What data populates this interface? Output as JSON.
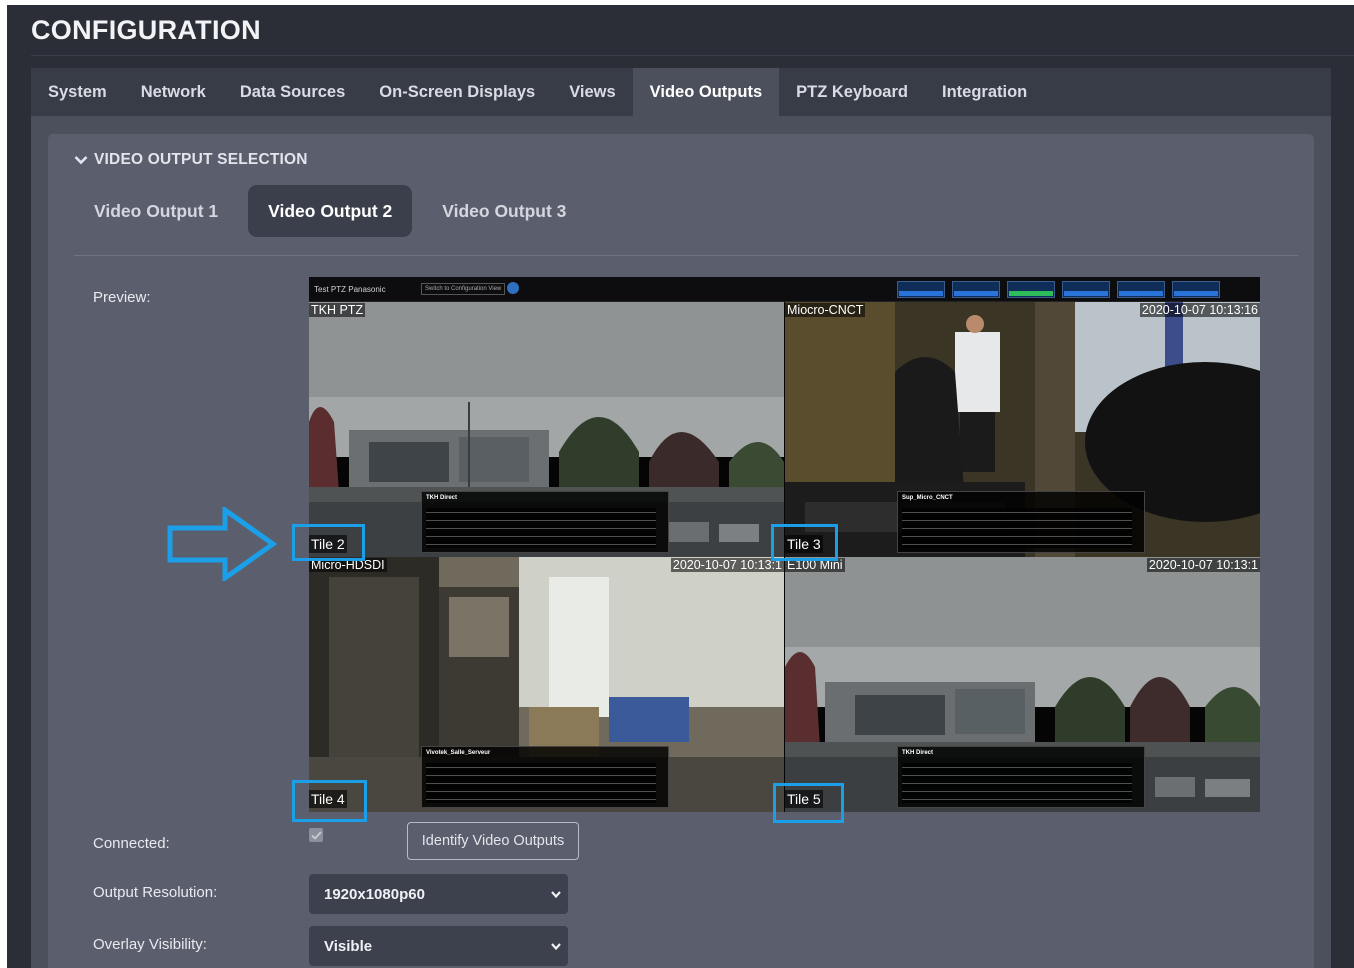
{
  "page": {
    "title": "CONFIGURATION"
  },
  "tabs": [
    "System",
    "Network",
    "Data Sources",
    "On-Screen Displays",
    "Views",
    "Video Outputs",
    "PTZ Keyboard",
    "Integration"
  ],
  "active_tab": "Video Outputs",
  "section": {
    "title": "VIDEO OUTPUT SELECTION",
    "expanded": true
  },
  "subtabs": [
    "Video Output 1",
    "Video Output 2",
    "Video Output 3"
  ],
  "active_subtab": "Video Output 2",
  "form": {
    "preview_label": "Preview:",
    "connected_label": "Connected:",
    "connected_checked": true,
    "identify_button": "Identify Video Outputs",
    "resolution_label": "Output Resolution:",
    "resolution_value": "1920x1080p60",
    "overlay_label": "Overlay Visibility:",
    "overlay_value": "Visible"
  },
  "preview": {
    "view_name": "Test PTZ Panasonic",
    "switch_button": "Switch to Configuration View",
    "tiles": [
      {
        "camera": "TKH PTZ",
        "timestamp": "",
        "label": "Tile 2",
        "info_title": "TKH Direct"
      },
      {
        "camera": "Miocro-CNCT",
        "timestamp": "2020-10-07 10:13:16",
        "label": "Tile 3",
        "info_title": "Sup_Micro_CNCT"
      },
      {
        "camera": "Micro-HDSDI",
        "timestamp": "2020-10-07 10:13:1",
        "label": "Tile 4",
        "info_title": "Vivotek_Salle_Serveur"
      },
      {
        "camera": "E100 Mini",
        "timestamp": "2020-10-07 10:13:1",
        "label": "Tile 5",
        "info_title": "TKH Direct"
      }
    ]
  },
  "colors": {
    "background": "#2b2e36",
    "tabbar": "#383c47",
    "panel": "#4c505d",
    "card": "#5b5f6d",
    "highlight": "#1a9fe8"
  },
  "icons": [
    "chevron-down-icon",
    "arrow-right-icon",
    "check-icon",
    "dropdown-caret-icon",
    "gear-icon"
  ]
}
